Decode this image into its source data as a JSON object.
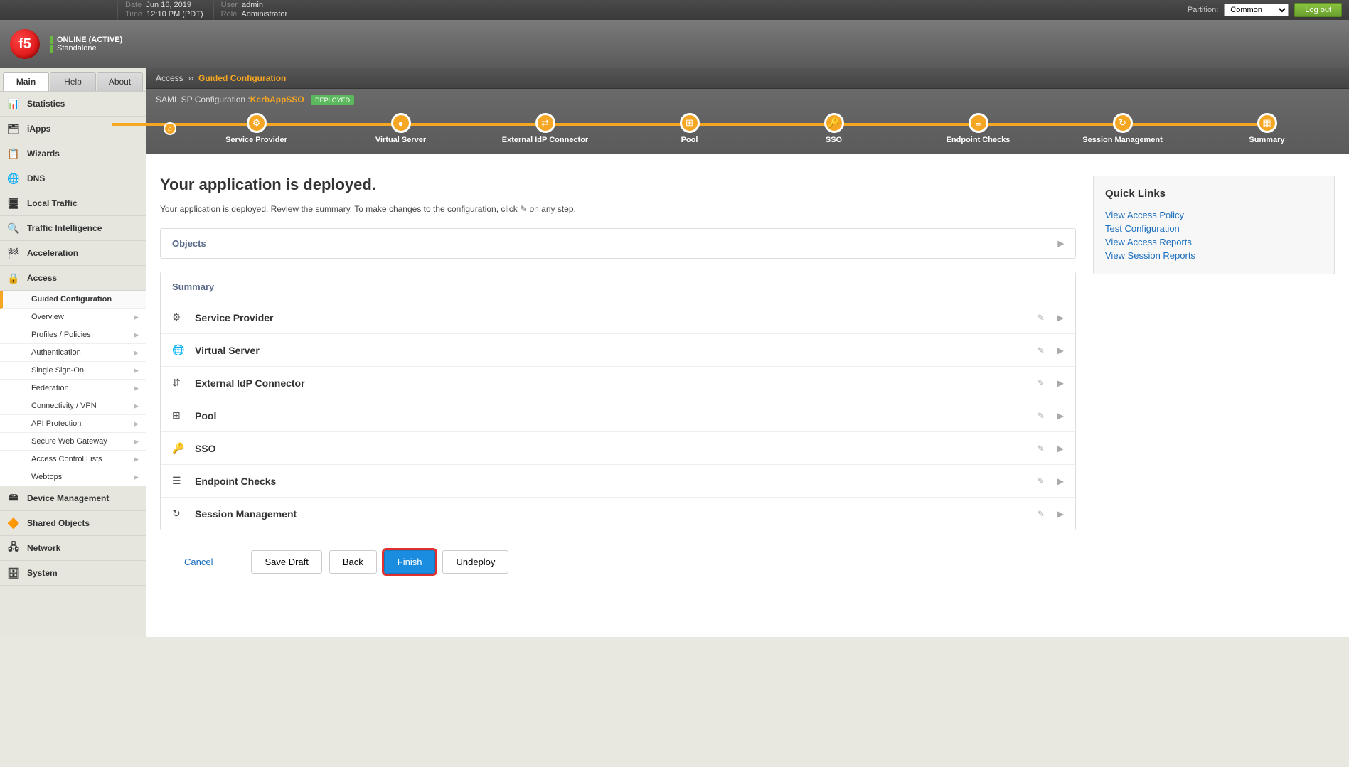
{
  "topbar": {
    "date_label": "Date",
    "date_value": "Jun 16, 2019",
    "time_label": "Time",
    "time_value": "12:10 PM (PDT)",
    "user_label": "User",
    "user_value": "admin",
    "role_label": "Role",
    "role_value": "Administrator",
    "partition_label": "Partition:",
    "partition_value": "Common",
    "logout": "Log out"
  },
  "header": {
    "logo_text": "f5",
    "status_line1": "ONLINE (ACTIVE)",
    "status_line2": "Standalone"
  },
  "tabs": {
    "main": "Main",
    "help": "Help",
    "about": "About"
  },
  "nav": {
    "statistics": "Statistics",
    "iapps": "iApps",
    "wizards": "Wizards",
    "dns": "DNS",
    "local_traffic": "Local Traffic",
    "traffic_intel": "Traffic Intelligence",
    "acceleration": "Acceleration",
    "access": "Access",
    "device_mgmt": "Device Management",
    "shared": "Shared Objects",
    "network": "Network",
    "system": "System"
  },
  "access_sub": [
    {
      "label": "Guided Configuration",
      "active": true,
      "caret": false
    },
    {
      "label": "Overview",
      "active": false,
      "caret": true
    },
    {
      "label": "Profiles / Policies",
      "active": false,
      "caret": true
    },
    {
      "label": "Authentication",
      "active": false,
      "caret": true
    },
    {
      "label": "Single Sign-On",
      "active": false,
      "caret": true
    },
    {
      "label": "Federation",
      "active": false,
      "caret": true
    },
    {
      "label": "Connectivity / VPN",
      "active": false,
      "caret": true
    },
    {
      "label": "API Protection",
      "active": false,
      "caret": true
    },
    {
      "label": "Secure Web Gateway",
      "active": false,
      "caret": true
    },
    {
      "label": "Access Control Lists",
      "active": false,
      "caret": true
    },
    {
      "label": "Webtops",
      "active": false,
      "caret": true
    }
  ],
  "breadcrumb": {
    "root": "Access",
    "sep": "››",
    "current": "Guided Configuration"
  },
  "config": {
    "prefix": "SAML SP Configuration :",
    "name": "KerbAppSSO",
    "badge": "DEPLOYED"
  },
  "steps": [
    {
      "label": "",
      "icon": "⌂",
      "small": true
    },
    {
      "label": "Service Provider",
      "icon": "⚙"
    },
    {
      "label": "Virtual Server",
      "icon": "●"
    },
    {
      "label": "External IdP Connector",
      "icon": "⇄"
    },
    {
      "label": "Pool",
      "icon": "⊞"
    },
    {
      "label": "SSO",
      "icon": "🔑"
    },
    {
      "label": "Endpoint Checks",
      "icon": "≡"
    },
    {
      "label": "Session Management",
      "icon": "↻"
    },
    {
      "label": "Summary",
      "icon": "▦"
    }
  ],
  "page": {
    "title": "Your application is deployed.",
    "desc_before": "Your application is deployed. Review the summary. To make changes to the configuration, click ",
    "desc_after": " on any step."
  },
  "objects_panel": "Objects",
  "summary_panel": "Summary",
  "summary_rows": [
    {
      "icon": "⚙",
      "label": "Service Provider"
    },
    {
      "icon": "🌐",
      "label": "Virtual Server"
    },
    {
      "icon": "⇵",
      "label": "External IdP Connector"
    },
    {
      "icon": "⊞",
      "label": "Pool"
    },
    {
      "icon": "🔑",
      "label": "SSO"
    },
    {
      "icon": "☰",
      "label": "Endpoint Checks"
    },
    {
      "icon": "↻",
      "label": "Session Management"
    }
  ],
  "quicklinks": {
    "title": "Quick Links",
    "links": [
      "View Access Policy",
      "Test Configuration",
      "View Access Reports",
      "View Session Reports"
    ]
  },
  "actions": {
    "cancel": "Cancel",
    "save_draft": "Save Draft",
    "back": "Back",
    "finish": "Finish",
    "undeploy": "Undeploy"
  }
}
